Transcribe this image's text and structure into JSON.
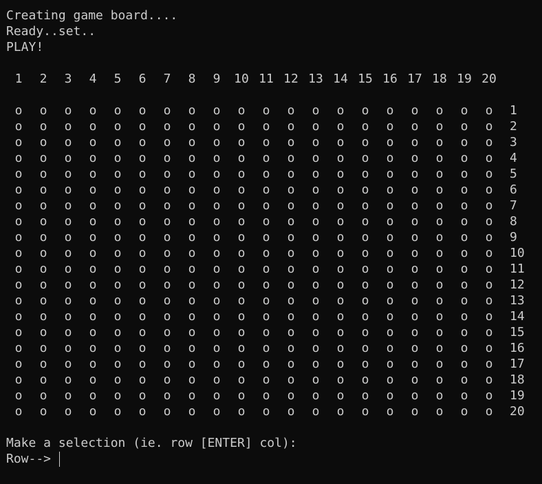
{
  "terminal": {
    "lines": [
      "Creating game board....",
      "Ready..set..",
      "PLAY!"
    ],
    "column_headers": [
      "1",
      "2",
      "3",
      "4",
      "5",
      "6",
      "7",
      "8",
      "9",
      "10",
      "11",
      "12",
      "13",
      "14",
      "15",
      "16",
      "17",
      "18",
      "19",
      "20"
    ],
    "row_labels": [
      "1",
      "2",
      "3",
      "4",
      "5",
      "6",
      "7",
      "8",
      "9",
      "10",
      "11",
      "12",
      "13",
      "14",
      "15",
      "16",
      "17",
      "18",
      "19",
      "20"
    ],
    "cell_symbol": "o",
    "selection_prompt": "Make a selection (ie. row [ENTER] col):",
    "row_prompt": "Row--> ",
    "input_value": ""
  },
  "colors": {
    "background": "#0c0c0c",
    "foreground": "#cccccc"
  }
}
